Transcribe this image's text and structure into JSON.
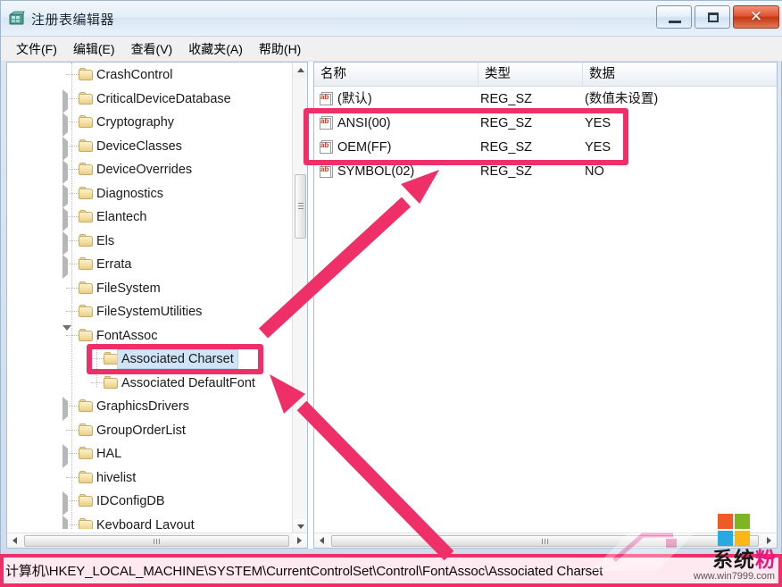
{
  "window": {
    "title": "注册表编辑器",
    "icon": "regedit-icon",
    "buttons": {
      "minimize": "最小化",
      "maximize": "最大化",
      "close": "关闭"
    }
  },
  "menubar": {
    "items": [
      {
        "label": "文件(F)",
        "name": "menu-file"
      },
      {
        "label": "编辑(E)",
        "name": "menu-edit"
      },
      {
        "label": "查看(V)",
        "name": "menu-view"
      },
      {
        "label": "收藏夹(A)",
        "name": "menu-favorites"
      },
      {
        "label": "帮助(H)",
        "name": "menu-help"
      }
    ]
  },
  "tree": {
    "items": [
      {
        "label": "CrashControl",
        "indent": 1,
        "expander": "none",
        "selected": false
      },
      {
        "label": "CriticalDeviceDatabase",
        "indent": 1,
        "expander": "closed",
        "selected": false
      },
      {
        "label": "Cryptography",
        "indent": 1,
        "expander": "closed",
        "selected": false
      },
      {
        "label": "DeviceClasses",
        "indent": 1,
        "expander": "closed",
        "selected": false
      },
      {
        "label": "DeviceOverrides",
        "indent": 1,
        "expander": "closed",
        "selected": false
      },
      {
        "label": "Diagnostics",
        "indent": 1,
        "expander": "closed",
        "selected": false
      },
      {
        "label": "Elantech",
        "indent": 1,
        "expander": "closed",
        "selected": false
      },
      {
        "label": "Els",
        "indent": 1,
        "expander": "closed",
        "selected": false
      },
      {
        "label": "Errata",
        "indent": 1,
        "expander": "closed",
        "selected": false
      },
      {
        "label": "FileSystem",
        "indent": 1,
        "expander": "none",
        "selected": false
      },
      {
        "label": "FileSystemUtilities",
        "indent": 1,
        "expander": "none",
        "selected": false
      },
      {
        "label": "FontAssoc",
        "indent": 1,
        "expander": "open",
        "selected": false
      },
      {
        "label": "Associated Charset",
        "indent": 2,
        "expander": "none",
        "selected": true
      },
      {
        "label": "Associated DefaultFont",
        "indent": 2,
        "expander": "none",
        "selected": false
      },
      {
        "label": "GraphicsDrivers",
        "indent": 1,
        "expander": "closed",
        "selected": false
      },
      {
        "label": "GroupOrderList",
        "indent": 1,
        "expander": "none",
        "selected": false
      },
      {
        "label": "HAL",
        "indent": 1,
        "expander": "closed",
        "selected": false
      },
      {
        "label": "hivelist",
        "indent": 1,
        "expander": "none",
        "selected": false
      },
      {
        "label": "IDConfigDB",
        "indent": 1,
        "expander": "closed",
        "selected": false
      },
      {
        "label": "Keyboard Layout",
        "indent": 1,
        "expander": "closed",
        "selected": false
      }
    ]
  },
  "list": {
    "columns": [
      "名称",
      "类型",
      "数据"
    ],
    "rows": [
      {
        "name": "(默认)",
        "type": "REG_SZ",
        "data": "(数值未设置)"
      },
      {
        "name": "ANSI(00)",
        "type": "REG_SZ",
        "data": "YES"
      },
      {
        "name": "OEM(FF)",
        "type": "REG_SZ",
        "data": "YES"
      },
      {
        "name": "SYMBOL(02)",
        "type": "REG_SZ",
        "data": "NO"
      }
    ]
  },
  "statusbar": {
    "path": "计算机\\HKEY_LOCAL_MACHINE\\SYSTEM\\CurrentControlSet\\Control\\FontAssoc\\Associated Charset"
  },
  "watermark": {
    "brand_part1": "系统",
    "brand_part2": "粉",
    "url": "www.win7999.com",
    "logo_colors": [
      "#f05a28",
      "#7cb722",
      "#29a9e1",
      "#fdb713"
    ]
  },
  "annotations": {
    "accent_color": "#ef2f68",
    "highlight_list_rows": "ANSI(00) / OEM(FF) rows boxed",
    "highlight_tree_key": "Associated Charset key boxed",
    "highlight_status_path": "registry path boxed",
    "arrow_count": 2
  }
}
